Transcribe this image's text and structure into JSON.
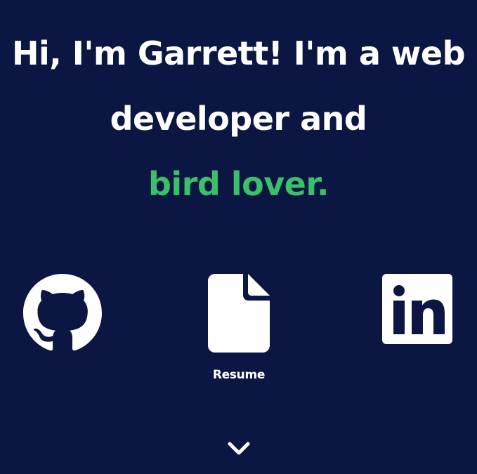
{
  "hero": {
    "line1": "Hi, I'm Garrett! I'm a web",
    "line2": "developer and",
    "line3": "bird lover.",
    "accent_color": "#3cbf6a",
    "background_color": "#0b1742"
  },
  "links": {
    "github_icon": "github-icon",
    "resume_icon": "document-icon",
    "resume_label": "Resume",
    "linkedin_icon": "linkedin-icon"
  },
  "scroll": {
    "icon": "chevron-down-icon"
  }
}
